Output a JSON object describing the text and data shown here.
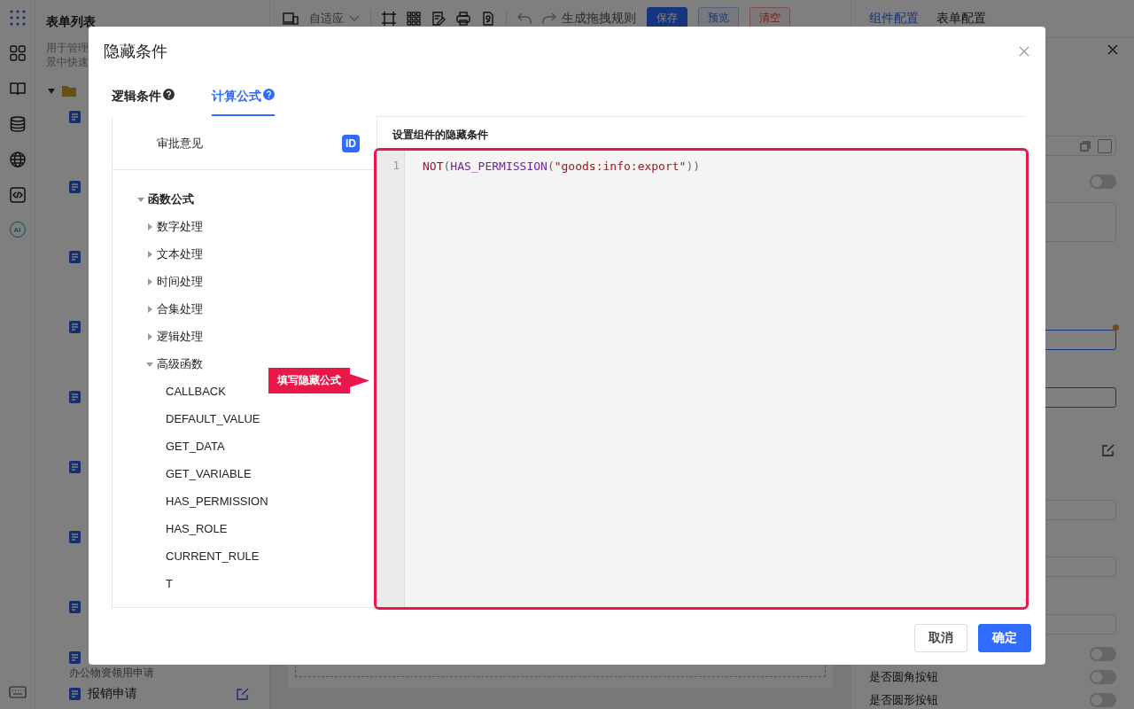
{
  "rail": {
    "ai_label": "AI"
  },
  "left_panel": {
    "title": "表单列表",
    "description_lines": [
      "用于管理",
      "景中快速"
    ],
    "bottom_items": [
      {
        "kind": "description",
        "text": "办公物资领用申请"
      },
      {
        "kind": "title",
        "text": "报销申请"
      }
    ]
  },
  "toolbar": {
    "device_select": "自适应",
    "generate": "生成拖拽规则",
    "buttons": [
      {
        "label": "保存",
        "kind": "primary"
      },
      {
        "label": "预览",
        "kind": "outline"
      },
      {
        "label": "清空",
        "kind": "danger"
      }
    ]
  },
  "right_panel": {
    "tabs": [
      {
        "label": "组件配置",
        "selected": true
      },
      {
        "label": "表单配置",
        "selected": false
      }
    ],
    "top_switch": {
      "on": false
    },
    "switch_rows": [
      {
        "on": false
      },
      {
        "label": "是否圆角按钮",
        "on": false
      },
      {
        "label": "是否圆形按钮",
        "on": false
      }
    ]
  },
  "dialog": {
    "title": "隐藏条件",
    "tabs": [
      {
        "label": "逻辑条件",
        "selected": false
      },
      {
        "label": "计算公式",
        "selected": true
      }
    ],
    "fields": [
      {
        "label": "审批意见",
        "badge": "ID"
      }
    ],
    "function_tree": [
      {
        "label": "函数公式",
        "expanded": true,
        "children": [
          {
            "label": "数字处理",
            "expanded": false
          },
          {
            "label": "文本处理",
            "expanded": false
          },
          {
            "label": "时间处理",
            "expanded": false
          },
          {
            "label": "合集处理",
            "expanded": false
          },
          {
            "label": "逻辑处理",
            "expanded": false
          },
          {
            "label": "高级函数",
            "expanded": true,
            "children": [
              {
                "label": "CALLBACK"
              },
              {
                "label": "DEFAULT_VALUE"
              },
              {
                "label": "GET_DATA"
              },
              {
                "label": "GET_VARIABLE"
              },
              {
                "label": "HAS_PERMISSION"
              },
              {
                "label": "HAS_ROLE"
              },
              {
                "label": "CURRENT_RULE"
              },
              {
                "label": "T"
              }
            ]
          }
        ]
      }
    ],
    "editor_label": "设置组件的隐藏条件",
    "code_lines": [
      {
        "number": "1",
        "tokens": [
          {
            "kind": "keyword",
            "text": "NOT"
          },
          {
            "kind": "punct",
            "text": "("
          },
          {
            "kind": "function",
            "text": "HAS_PERMISSION"
          },
          {
            "kind": "punct",
            "text": "("
          },
          {
            "kind": "string",
            "text": "\"goods:info:export\""
          },
          {
            "kind": "punct",
            "text": "))"
          }
        ]
      }
    ],
    "callout": "填写隐藏公式",
    "buttons": [
      {
        "label": "取消",
        "kind": "default"
      },
      {
        "label": "确定",
        "kind": "primary"
      }
    ]
  }
}
